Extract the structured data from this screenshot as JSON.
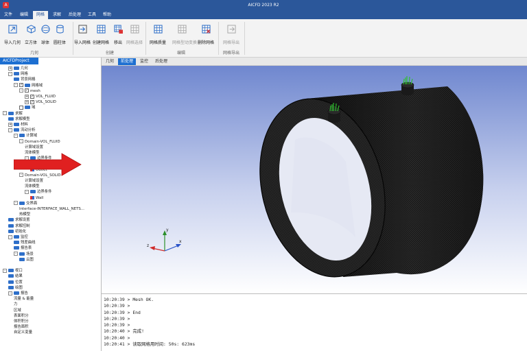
{
  "app": {
    "icon_text": "A",
    "title": "AICFD 2023 R2"
  },
  "menus": [
    "文件",
    "编辑",
    "网格",
    "求解",
    "后处理",
    "工具",
    "帮助"
  ],
  "ribbon": {
    "groups": [
      "几何",
      "创建",
      "编辑",
      "网格导出"
    ],
    "buttons": [
      "导入几何",
      "立方体",
      "球体",
      "圆柱体",
      "导入网格",
      "创建网格",
      "移出",
      "网格选择",
      "网格质量",
      "网格型动变换",
      "删除网格",
      "网格导出"
    ]
  },
  "left": {
    "project_tab": "AICFDProject"
  },
  "tree": [
    {
      "label": "几何",
      "ex": "+",
      "icon": "folder"
    },
    {
      "label": "网格",
      "ex": "-",
      "icon": "folder"
    },
    {
      "label": "背景网格",
      "icon": "folder"
    },
    {
      "label": "网格域",
      "ex": "-",
      "cb": "✓",
      "icon": "folder"
    },
    {
      "label": "mesh",
      "ex": "-",
      "cb": "✓"
    },
    {
      "label": "VOL_FLUID",
      "ex": "+",
      "cb": "✓"
    },
    {
      "label": "VOL_SOLID",
      "ex": "+",
      "cb": "✓"
    },
    {
      "label": "域",
      "cb": "",
      "icon": "folder"
    },
    {
      "label": "求解",
      "ex": "-",
      "icon": "folder"
    },
    {
      "label": "求解模型",
      "icon": "folder"
    },
    {
      "label": "材料",
      "ex": "+",
      "icon": "folder"
    },
    {
      "label": "流动分析",
      "ex": "-",
      "icon": "folder"
    },
    {
      "label": "计算域",
      "ex": "-",
      "icon": "folder"
    },
    {
      "label": "Domain-VOL_FLUID",
      "ex": "-"
    },
    {
      "label": "计算域设置"
    },
    {
      "label": "流体模型"
    },
    {
      "label": "边界条件",
      "ex": "-",
      "icon": "folder"
    },
    {
      "label": "Inlet",
      "icon": "bc"
    },
    {
      "label": "Outlet",
      "icon": "bc"
    },
    {
      "label": "Domain-VOL_SOLID",
      "ex": "-"
    },
    {
      "label": "计算域设置"
    },
    {
      "label": "流体模型"
    },
    {
      "label": "边界条件",
      "ex": "-",
      "icon": "folder"
    },
    {
      "label": "Wall",
      "icon": "bc"
    },
    {
      "label": "交界面",
      "ex": "-",
      "icon": "folder"
    },
    {
      "label": "Interface-INTERFACE_WALL_NETS...",
      "icon": "none"
    },
    {
      "label": "热模型"
    },
    {
      "label": "求解设置",
      "icon": "folder"
    },
    {
      "label": "求解控制",
      "icon": "folder"
    },
    {
      "label": "初始化",
      "icon": "folder"
    },
    {
      "label": "监控",
      "ex": "-",
      "icon": "folder"
    },
    {
      "label": "残差曲线",
      "icon": "folder"
    },
    {
      "label": "报告表",
      "icon": "folder"
    },
    {
      "label": "场景",
      "ex": "-",
      "icon": "folder"
    },
    {
      "label": "云图",
      "icon": "folder"
    },
    {
      "label": ""
    },
    {
      "label": "视口",
      "ex": "-",
      "icon": "folder"
    },
    {
      "label": "结果",
      "icon": "folder"
    },
    {
      "label": "位置",
      "icon": "folder"
    },
    {
      "label": "绘图",
      "icon": "folder"
    },
    {
      "label": "报告",
      "ex": "-",
      "icon": "folder"
    },
    {
      "label": "流量 & 能量"
    },
    {
      "label": "力"
    },
    {
      "label": "区域"
    },
    {
      "label": "表面积分"
    },
    {
      "label": "体积积分"
    },
    {
      "label": "报告面积"
    },
    {
      "label": "自定义变量"
    }
  ],
  "view_tabs": [
    "几何",
    "前处理",
    "监控",
    "后处理"
  ],
  "axes": {
    "x": "x",
    "y": "y",
    "z": "z"
  },
  "console": [
    "10:20:39 > Mesh OK.",
    "10:20:39 >",
    "10:20:39 > End",
    "10:20:39 >",
    "10:20:39 >",
    "10:20:40 > 完成!",
    "10:20:40 >",
    "10:20:41 > 读取网格用时间: 50s: 623ms"
  ],
  "colors": {
    "accent": "#2b579a",
    "active_tab": "#1d6fd1",
    "arrow": "#e02020"
  }
}
